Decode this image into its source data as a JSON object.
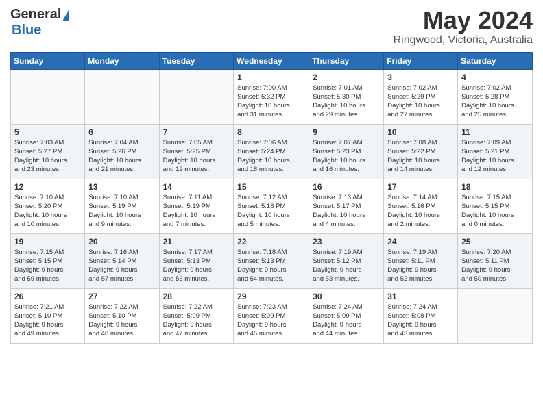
{
  "logo": {
    "general": "General",
    "blue": "Blue"
  },
  "title": {
    "month_year": "May 2024",
    "location": "Ringwood, Victoria, Australia"
  },
  "days_of_week": [
    "Sunday",
    "Monday",
    "Tuesday",
    "Wednesday",
    "Thursday",
    "Friday",
    "Saturday"
  ],
  "weeks": [
    [
      {
        "day": "",
        "info": ""
      },
      {
        "day": "",
        "info": ""
      },
      {
        "day": "",
        "info": ""
      },
      {
        "day": "1",
        "info": "Sunrise: 7:00 AM\nSunset: 5:32 PM\nDaylight: 10 hours\nand 31 minutes."
      },
      {
        "day": "2",
        "info": "Sunrise: 7:01 AM\nSunset: 5:30 PM\nDaylight: 10 hours\nand 29 minutes."
      },
      {
        "day": "3",
        "info": "Sunrise: 7:02 AM\nSunset: 5:29 PM\nDaylight: 10 hours\nand 27 minutes."
      },
      {
        "day": "4",
        "info": "Sunrise: 7:02 AM\nSunset: 5:28 PM\nDaylight: 10 hours\nand 25 minutes."
      }
    ],
    [
      {
        "day": "5",
        "info": "Sunrise: 7:03 AM\nSunset: 5:27 PM\nDaylight: 10 hours\nand 23 minutes."
      },
      {
        "day": "6",
        "info": "Sunrise: 7:04 AM\nSunset: 5:26 PM\nDaylight: 10 hours\nand 21 minutes."
      },
      {
        "day": "7",
        "info": "Sunrise: 7:05 AM\nSunset: 5:25 PM\nDaylight: 10 hours\nand 19 minutes."
      },
      {
        "day": "8",
        "info": "Sunrise: 7:06 AM\nSunset: 5:24 PM\nDaylight: 10 hours\nand 18 minutes."
      },
      {
        "day": "9",
        "info": "Sunrise: 7:07 AM\nSunset: 5:23 PM\nDaylight: 10 hours\nand 16 minutes."
      },
      {
        "day": "10",
        "info": "Sunrise: 7:08 AM\nSunset: 5:22 PM\nDaylight: 10 hours\nand 14 minutes."
      },
      {
        "day": "11",
        "info": "Sunrise: 7:09 AM\nSunset: 5:21 PM\nDaylight: 10 hours\nand 12 minutes."
      }
    ],
    [
      {
        "day": "12",
        "info": "Sunrise: 7:10 AM\nSunset: 5:20 PM\nDaylight: 10 hours\nand 10 minutes."
      },
      {
        "day": "13",
        "info": "Sunrise: 7:10 AM\nSunset: 5:19 PM\nDaylight: 10 hours\nand 9 minutes."
      },
      {
        "day": "14",
        "info": "Sunrise: 7:11 AM\nSunset: 5:19 PM\nDaylight: 10 hours\nand 7 minutes."
      },
      {
        "day": "15",
        "info": "Sunrise: 7:12 AM\nSunset: 5:18 PM\nDaylight: 10 hours\nand 5 minutes."
      },
      {
        "day": "16",
        "info": "Sunrise: 7:13 AM\nSunset: 5:17 PM\nDaylight: 10 hours\nand 4 minutes."
      },
      {
        "day": "17",
        "info": "Sunrise: 7:14 AM\nSunset: 5:16 PM\nDaylight: 10 hours\nand 2 minutes."
      },
      {
        "day": "18",
        "info": "Sunrise: 7:15 AM\nSunset: 5:15 PM\nDaylight: 10 hours\nand 0 minutes."
      }
    ],
    [
      {
        "day": "19",
        "info": "Sunrise: 7:15 AM\nSunset: 5:15 PM\nDaylight: 9 hours\nand 59 minutes."
      },
      {
        "day": "20",
        "info": "Sunrise: 7:16 AM\nSunset: 5:14 PM\nDaylight: 9 hours\nand 57 minutes."
      },
      {
        "day": "21",
        "info": "Sunrise: 7:17 AM\nSunset: 5:13 PM\nDaylight: 9 hours\nand 56 minutes."
      },
      {
        "day": "22",
        "info": "Sunrise: 7:18 AM\nSunset: 5:13 PM\nDaylight: 9 hours\nand 54 minutes."
      },
      {
        "day": "23",
        "info": "Sunrise: 7:19 AM\nSunset: 5:12 PM\nDaylight: 9 hours\nand 53 minutes."
      },
      {
        "day": "24",
        "info": "Sunrise: 7:19 AM\nSunset: 5:11 PM\nDaylight: 9 hours\nand 52 minutes."
      },
      {
        "day": "25",
        "info": "Sunrise: 7:20 AM\nSunset: 5:11 PM\nDaylight: 9 hours\nand 50 minutes."
      }
    ],
    [
      {
        "day": "26",
        "info": "Sunrise: 7:21 AM\nSunset: 5:10 PM\nDaylight: 9 hours\nand 49 minutes."
      },
      {
        "day": "27",
        "info": "Sunrise: 7:22 AM\nSunset: 5:10 PM\nDaylight: 9 hours\nand 48 minutes."
      },
      {
        "day": "28",
        "info": "Sunrise: 7:22 AM\nSunset: 5:09 PM\nDaylight: 9 hours\nand 47 minutes."
      },
      {
        "day": "29",
        "info": "Sunrise: 7:23 AM\nSunset: 5:09 PM\nDaylight: 9 hours\nand 45 minutes."
      },
      {
        "day": "30",
        "info": "Sunrise: 7:24 AM\nSunset: 5:09 PM\nDaylight: 9 hours\nand 44 minutes."
      },
      {
        "day": "31",
        "info": "Sunrise: 7:24 AM\nSunset: 5:08 PM\nDaylight: 9 hours\nand 43 minutes."
      },
      {
        "day": "",
        "info": ""
      }
    ]
  ]
}
